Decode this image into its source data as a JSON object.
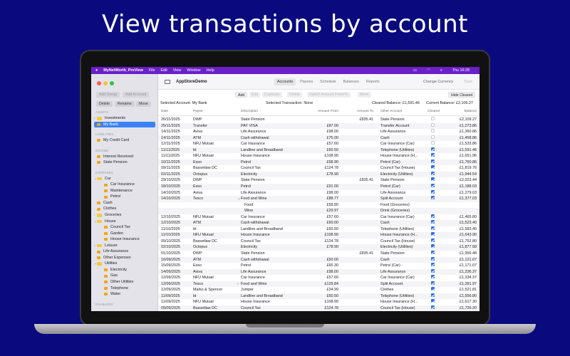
{
  "headline": "View transactions by account",
  "menubar": {
    "app": "MyNetWorth_PreView",
    "items": [
      "File",
      "Edit",
      "View",
      "Window",
      "Help"
    ],
    "clock": "Thu 16:28"
  },
  "sidebar": {
    "buttons": {
      "add_group": "Add Group",
      "add_account": "Add Account",
      "delete": "Delete",
      "rename": "Rename",
      "move": "Move"
    },
    "tree": [
      {
        "type": "section",
        "label": "ASSETS"
      },
      {
        "type": "folder",
        "label": "Investments",
        "level": 0,
        "chevron": "right"
      },
      {
        "type": "account",
        "label": "My Bank",
        "level": 0,
        "selected": true
      },
      {
        "type": "section",
        "label": "LIABILITIES"
      },
      {
        "type": "account",
        "label": "My Credit Card",
        "level": 0
      },
      {
        "type": "section",
        "label": "INCOME"
      },
      {
        "type": "account",
        "label": "Interest Received",
        "level": 0
      },
      {
        "type": "account",
        "label": "State Pension",
        "level": 0
      },
      {
        "type": "section",
        "label": "EXPENSES"
      },
      {
        "type": "folder",
        "label": "Car",
        "level": 0,
        "chevron": "down"
      },
      {
        "type": "account",
        "label": "Car Insurance",
        "level": 1
      },
      {
        "type": "account",
        "label": "Maintenance",
        "level": 1
      },
      {
        "type": "account",
        "label": "Petrol",
        "level": 1
      },
      {
        "type": "account",
        "label": "Cash",
        "level": 0
      },
      {
        "type": "account",
        "label": "Clothes",
        "level": 0
      },
      {
        "type": "folder",
        "label": "Groceries",
        "level": 0,
        "chevron": "right"
      },
      {
        "type": "folder",
        "label": "House",
        "level": 0,
        "chevron": "down"
      },
      {
        "type": "account",
        "label": "Council Tax",
        "level": 1
      },
      {
        "type": "account",
        "label": "Garden",
        "level": 1
      },
      {
        "type": "account",
        "label": "House Insurance",
        "level": 1
      },
      {
        "type": "folder",
        "label": "Leisure",
        "level": 0,
        "chevron": "right"
      },
      {
        "type": "account",
        "label": "Life Assurance",
        "level": 0
      },
      {
        "type": "account",
        "label": "Other Expenses",
        "level": 0
      },
      {
        "type": "folder",
        "label": "Utilities",
        "level": 0,
        "chevron": "down"
      },
      {
        "type": "account",
        "label": "Electricity",
        "level": 1
      },
      {
        "type": "account",
        "label": "Gas",
        "level": 1
      },
      {
        "type": "account",
        "label": "Other Utilities",
        "level": 1
      },
      {
        "type": "account",
        "label": "Telephone",
        "level": 1
      },
      {
        "type": "account",
        "label": "Water",
        "level": 1
      },
      {
        "type": "section",
        "label": "ENABLERS"
      }
    ]
  },
  "header": {
    "title": "AppStoreDemo",
    "tabs": [
      "Accounts",
      "Payees",
      "Schedule",
      "Balances",
      "Reports"
    ],
    "active_tab": "Accounts",
    "change_currency": "Change Currency",
    "save": "Save"
  },
  "toolbar": {
    "add": "Add",
    "edit": "Edit",
    "duplicate": "Duplicate",
    "delete": "Delete",
    "switch": "Switch Amount From/To",
    "move": "Move",
    "hide_cleared": "Hide Cleared"
  },
  "info": {
    "selected_account": "Selected Account:  My Bank",
    "selected_transaction": "Selected Transaction:  None",
    "cleared_balance": "Cleared Balance:  £1,591.46",
    "current_balance": "Current Balance:  £2,109.27"
  },
  "table": {
    "columns": [
      "Date",
      "Payee",
      "Description",
      "Amount From",
      "Amount To",
      "Other Account",
      "Cleared",
      "Balance"
    ],
    "rows": [
      [
        "26/11/2025",
        "DWP",
        "State Pension",
        "",
        "£835.41",
        "State Pension",
        false,
        "£2,109.27",
        ""
      ],
      [
        "25/11/2025",
        "Transfer",
        "PAY VISA",
        "£87.00",
        "",
        "Transfer Account",
        false,
        "£1,273.86",
        ""
      ],
      [
        "14/11/2025",
        "Aviva",
        "Life Assurance",
        "£98.00",
        "",
        "Life Assurance",
        false,
        "£1,360.86",
        ""
      ],
      [
        "14/11/2025",
        "ATM",
        "Cash withdrawal",
        "£75.00",
        "",
        "Cash",
        false,
        "£1,458.86",
        ""
      ],
      [
        "12/11/2025",
        "NFU Mutual",
        "Car Insurance",
        "£57.60",
        "",
        "Car Insurance (Car)",
        false,
        "£1,533.86",
        ""
      ],
      [
        "11/11/2025",
        "bt",
        "Landline and Broadband",
        "£60.50",
        "",
        "Telephone (Utilities)",
        true,
        "£1,591.46",
        ""
      ],
      [
        "11/11/2025",
        "NFU Mutual",
        "House Insurance",
        "£108.90",
        "",
        "House Insurance (H...",
        true,
        "£1,651.96",
        ""
      ],
      [
        "10/11/2025",
        "Esso",
        "Petrol",
        "£58.90",
        "",
        "Petrol (Car)",
        true,
        "£1,760.86",
        ""
      ],
      [
        "09/11/2025",
        "Bassetlaw DC",
        "Council Tax",
        "£124.78",
        "",
        "Council Tax (House)",
        true,
        "£1,819.76",
        ""
      ],
      [
        "02/11/2025",
        "Octopus",
        "Electricity",
        "£78.90",
        "",
        "Electricity (Utilities)",
        true,
        "£1,944.54",
        ""
      ],
      [
        "29/10/2025",
        "DWP",
        "State Pension",
        "",
        "£835.41",
        "State Pension",
        true,
        "£2,023.44",
        ""
      ],
      [
        "18/10/2025",
        "Esso",
        "Petrol",
        "£91.00",
        "",
        "Petrol (Car)",
        true,
        "£1,188.03",
        ""
      ],
      [
        "14/10/2025",
        "Aviva",
        "Life Assurance",
        "£98.00",
        "",
        "Life Assurance",
        true,
        "£1,279.03",
        ""
      ],
      [
        "14/10/2025",
        "Tesco",
        "Food and Wine",
        "£88.77",
        "",
        "Split Account",
        true,
        "£1,377.03",
        "down"
      ],
      [
        "",
        "",
        "Food",
        "£58.80",
        "",
        "Food (Groceries)",
        null,
        "",
        "split"
      ],
      [
        "",
        "",
        "Wine",
        "£29.97",
        "",
        "Drink (Groceries)",
        null,
        "",
        "split"
      ],
      [
        "12/10/2025",
        "NFU Mutual",
        "Car Insurance",
        "£57.60",
        "",
        "Car Insurance (Car)",
        true,
        "£1,465.80",
        ""
      ],
      [
        "12/10/2025",
        "ATM",
        "Cash withdrawal",
        "£60.00",
        "",
        "Cash",
        true,
        "£1,523.40",
        ""
      ],
      [
        "11/10/2025",
        "bt",
        "Landline and Broadband",
        "£60.50",
        "",
        "Telephone (Utilities)",
        true,
        "£1,583.40",
        ""
      ],
      [
        "11/10/2025",
        "NFU Mutual",
        "House Insurance",
        "£108.90",
        "",
        "House Insurance (H...",
        true,
        "£1,643.90",
        ""
      ],
      [
        "09/10/2025",
        "Bassetlaw DC",
        "Council Tax",
        "£124.78",
        "",
        "Council Tax (House)",
        true,
        "£1,752.80",
        ""
      ],
      [
        "02/10/2025",
        "Octopus",
        "Electricity",
        "£78.90",
        "",
        "Electricity (Utilities)",
        true,
        "£1,877.58",
        ""
      ],
      [
        "01/10/2025",
        "DWP",
        "State Pension",
        "",
        "£835.41",
        "State Pension",
        true,
        "£1,956.48",
        ""
      ],
      [
        "16/09/2025",
        "ATM",
        "Cash withdrawal",
        "£50.00",
        "",
        "Cash",
        true,
        "£1,121.07",
        ""
      ],
      [
        "15/09/2025",
        "Esso",
        "Petrol",
        "£65.30",
        "",
        "Petrol (Car)",
        true,
        "£1,171.07",
        ""
      ],
      [
        "14/09/2025",
        "Aviva",
        "Life Assurance",
        "£98.00",
        "",
        "Life Assurance",
        true,
        "£1,236.37",
        ""
      ],
      [
        "12/09/2025",
        "NFU Mutual",
        "Car Insurance",
        "£57.60",
        "",
        "Car Insurance (Car)",
        true,
        "£1,334.37",
        ""
      ],
      [
        "12/09/2025",
        "Tesco",
        "Food and Wine",
        "£129.84",
        "",
        "Split Account",
        true,
        "£1,391.97",
        "right"
      ],
      [
        "12/09/2025",
        "Marks & Spencer",
        "Jumper",
        "£34.99",
        "",
        "Clothes",
        true,
        "£1,521.81",
        ""
      ],
      [
        "11/09/2025",
        "bt",
        "Landline and Broadband",
        "£60.50",
        "",
        "Telephone (Utilities)",
        true,
        "£1,556.80",
        ""
      ],
      [
        "11/09/2025",
        "NFU Mutual",
        "House Insurance",
        "£108.90",
        "",
        "House Insurance (H...",
        true,
        "£1,617.30",
        ""
      ],
      [
        "09/09/2025",
        "Bassetlaw DC",
        "Council Tax",
        "£124.78",
        "",
        "Council Tax (House)",
        true,
        "£1,726.20",
        ""
      ]
    ]
  },
  "colors": {
    "background": "#0a0a7e",
    "menubar": "#6b20c8",
    "selection": "#3b82f6",
    "checkbox": "#2f6fe8",
    "account_icon": "#f2a712",
    "folder_icon": "#f5c93a"
  }
}
